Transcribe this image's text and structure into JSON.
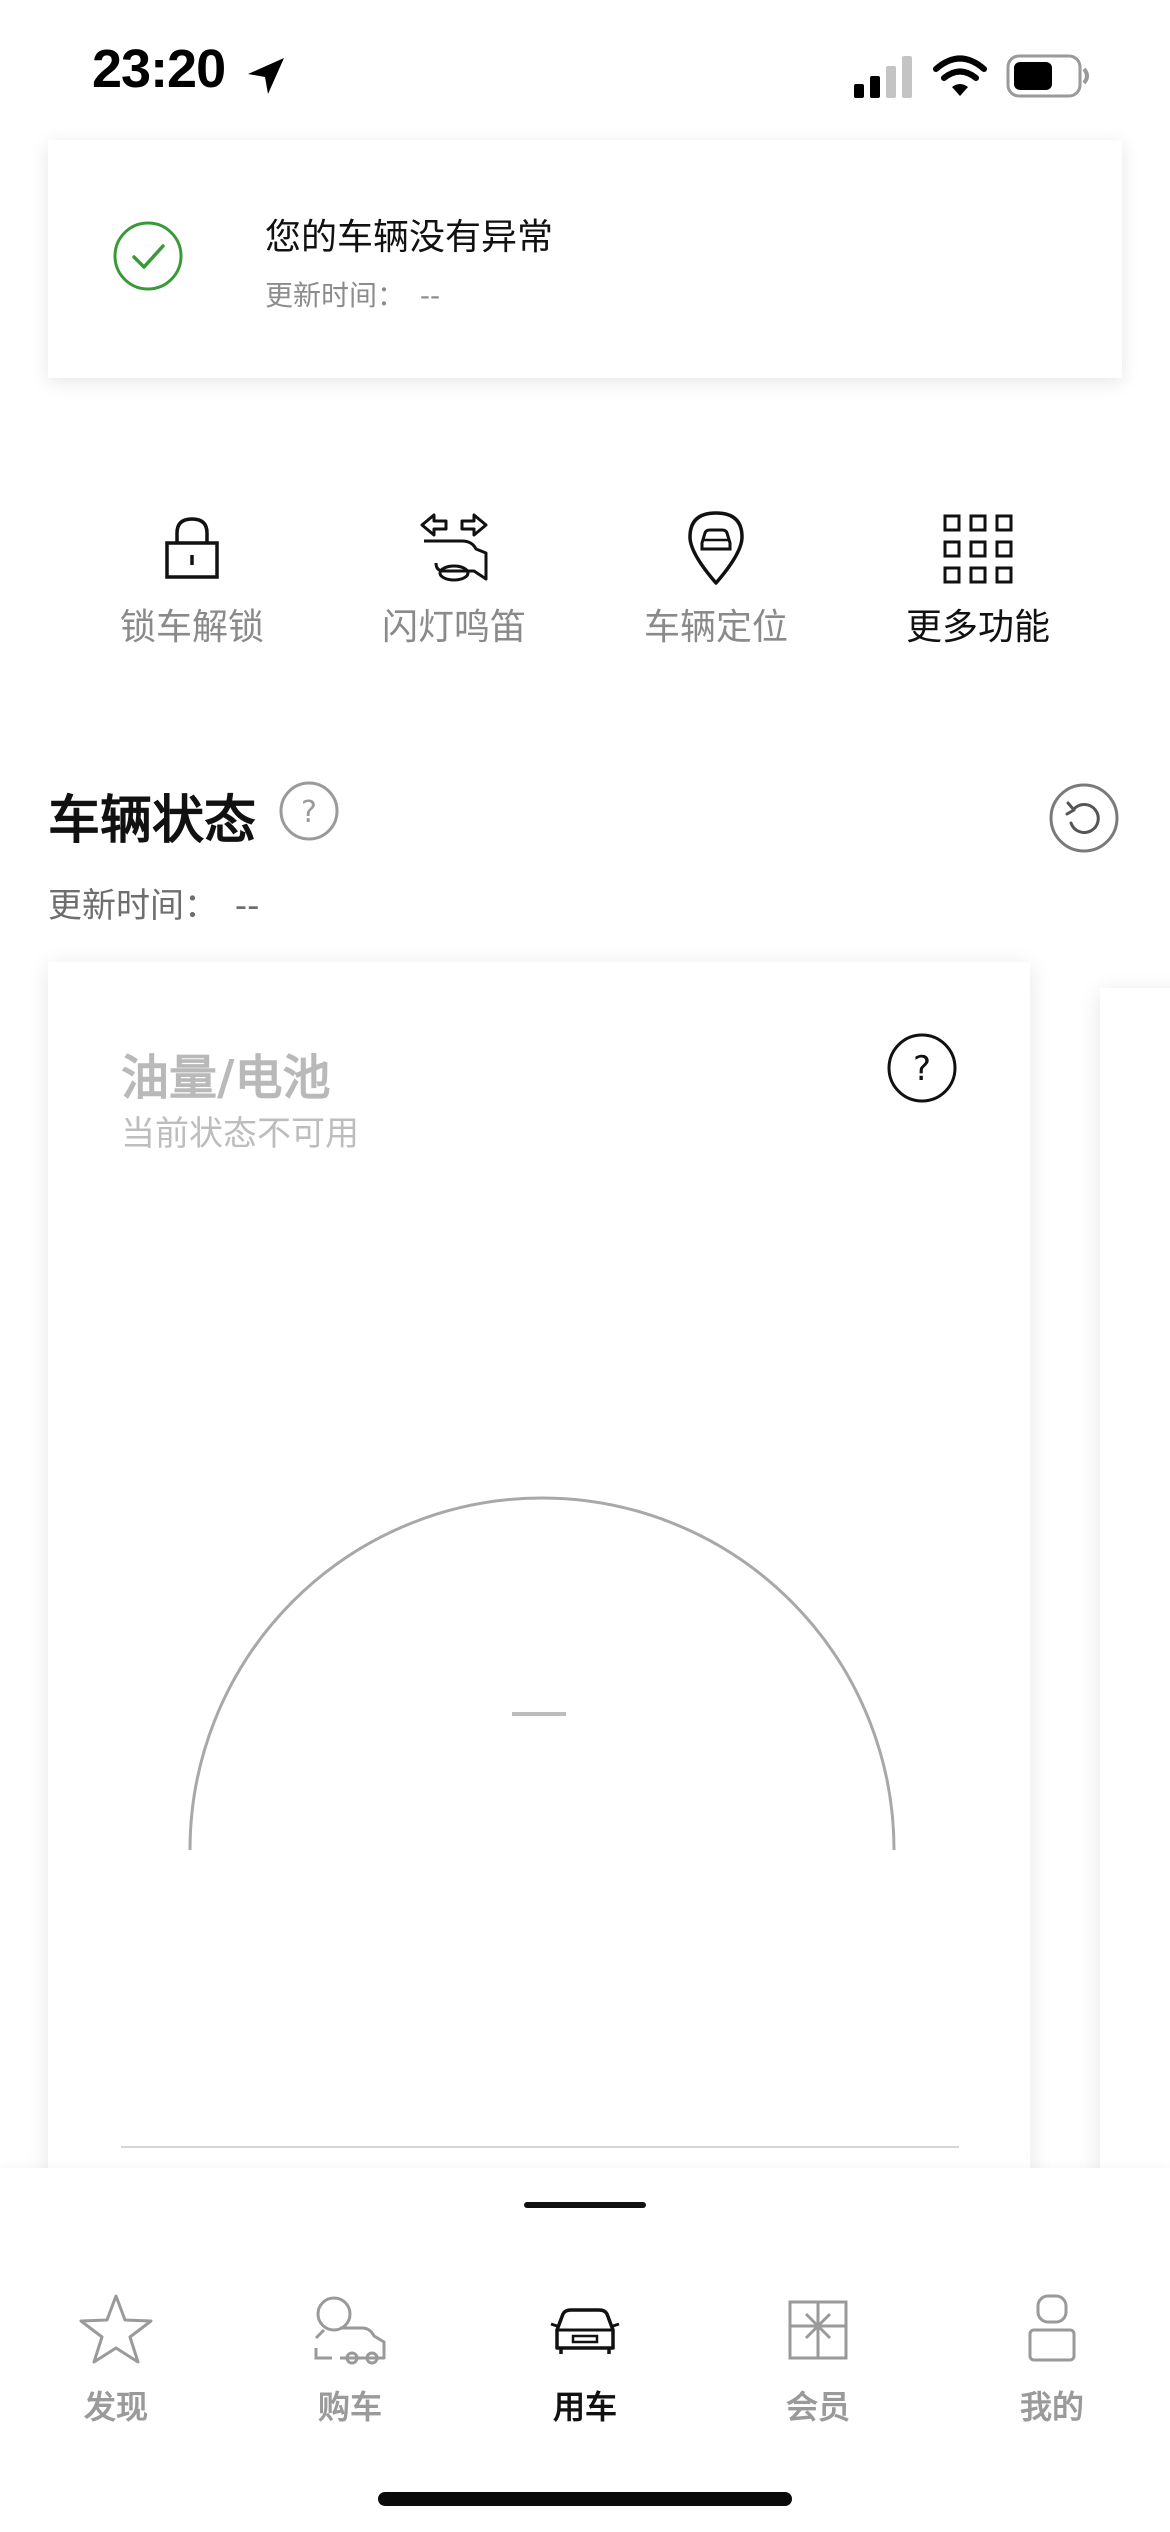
{
  "status_bar": {
    "time": "23:20",
    "icons": [
      "location-arrow-icon",
      "cellular-signal-icon",
      "wifi-icon",
      "battery-icon"
    ]
  },
  "alert": {
    "icon": "check-circle-icon",
    "title": "您的车辆没有异常",
    "update_label": "更新时间：",
    "update_value": "--",
    "accent_color": "#3a9a3a"
  },
  "actions": [
    {
      "label": "锁车解锁",
      "icon": "lock-icon"
    },
    {
      "label": "闪灯鸣笛",
      "icon": "flash-horn-icon"
    },
    {
      "label": "车辆定位",
      "icon": "car-location-pin-icon"
    },
    {
      "label": "更多功能",
      "icon": "grid-icon"
    }
  ],
  "vehicle_status": {
    "title": "车辆状态",
    "update_label": "更新时间：",
    "update_value": "--",
    "help_icon": "question-circle-icon",
    "refresh_icon": "refresh-icon"
  },
  "fuel_card": {
    "title": "油量/电池",
    "subtitle": "当前状态不可用",
    "value": "—",
    "help_icon": "question-circle-icon"
  },
  "bottom_nav": [
    {
      "label": "发现",
      "icon": "star-icon",
      "active": false
    },
    {
      "label": "购车",
      "icon": "car-search-icon",
      "active": false
    },
    {
      "label": "用车",
      "icon": "car-icon",
      "active": true
    },
    {
      "label": "会员",
      "icon": "gift-icon",
      "active": false
    },
    {
      "label": "我的",
      "icon": "user-icon",
      "active": false
    }
  ]
}
